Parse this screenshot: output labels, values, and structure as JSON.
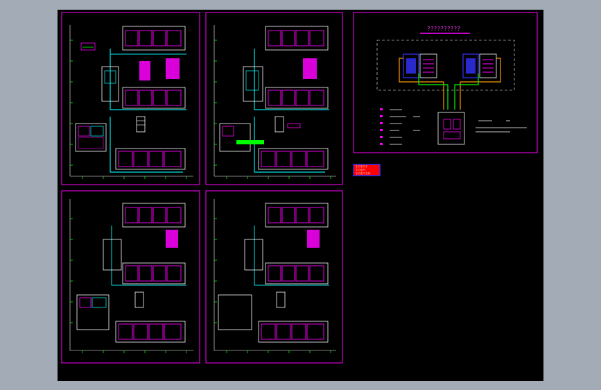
{
  "drawing": {
    "background_color": "#000000",
    "frame_color": "#d400d4",
    "wall_color": "#ffffff",
    "room_color": "#ff00ff",
    "wire_color": "#00e5e5",
    "green_color": "#00ff00",
    "orange_color": "#ff9900",
    "blue_color": "#3333ff"
  },
  "sheets": [
    {
      "id": "sheet-1",
      "name": "floor-plan-1"
    },
    {
      "id": "sheet-2",
      "name": "floor-plan-2"
    },
    {
      "id": "sheet-3",
      "name": "floor-plan-3"
    },
    {
      "id": "sheet-4",
      "name": "floor-plan-4"
    }
  ],
  "system_diagram": {
    "title": "??????????"
  },
  "title_stamp": {
    "line1": "???????",
    "line2": "??????",
    "line3": "?????????"
  }
}
